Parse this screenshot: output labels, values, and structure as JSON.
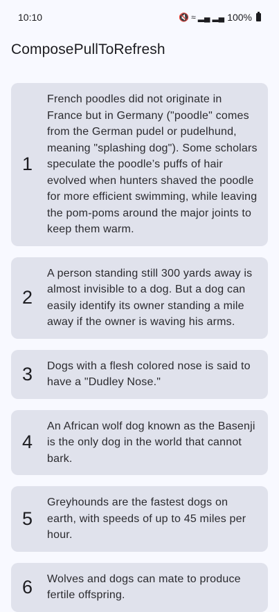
{
  "status_bar": {
    "time": "10:10",
    "icons": [
      "mute-icon",
      "wifi-icon",
      "signal-icon",
      "signal-icon"
    ],
    "battery": "100%"
  },
  "app": {
    "title": "ComposePullToRefresh"
  },
  "items": [
    {
      "number": "1",
      "text": "French poodles did not originate in France but in Germany (\"poodle\" comes from the German pudel or pudelhund, meaning \"splashing dog\"). Some scholars speculate the poodle’s puffs of hair evolved when hunters shaved the poodle for more efficient swimming, while leaving the pom-poms around the major joints to keep them warm."
    },
    {
      "number": "2",
      "text": "A person standing still 300 yards away is almost invisible to a dog. But a dog can easily identify its owner standing a mile away if the owner is waving his arms."
    },
    {
      "number": "3",
      "text": "Dogs with a flesh colored nose is said to have a \"Dudley Nose.\""
    },
    {
      "number": "4",
      "text": "An African wolf dog known as the Basenji is the only dog in the world that cannot bark."
    },
    {
      "number": "5",
      "text": "Greyhounds are the fastest dogs on earth, with speeds of up to 45 miles per hour."
    },
    {
      "number": "6",
      "text": "Wolves and dogs can mate to produce fertile offspring."
    }
  ]
}
